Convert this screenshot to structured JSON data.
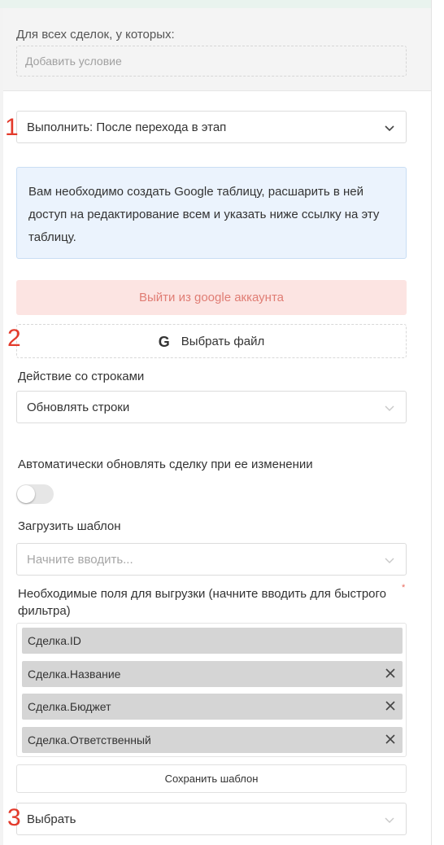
{
  "condition": {
    "title": "Для всех сделок, у которых:",
    "add_placeholder": "Добавить условие"
  },
  "markers": [
    "1",
    "2",
    "3"
  ],
  "execute_select": {
    "value": "Выполнить: После перехода в этап"
  },
  "info": {
    "text": "Вам необходимо создать Google таблицу, расшарить в ней доступ на редактирование всем и указать ниже ссылку на эту таблицу."
  },
  "logout_button": "Выйти из google аккаунта",
  "choose_file": {
    "icon": "G",
    "label": "Выбрать файл"
  },
  "row_action": {
    "label": "Действие со строками",
    "value": "Обновлять строки"
  },
  "auto_update": {
    "label": "Автоматически обновлять сделку при ее изменении",
    "enabled": false
  },
  "template": {
    "label": "Загрузить шаблон",
    "placeholder": "Начните вводить..."
  },
  "fields": {
    "label": "Необходимые поля для выгрузки (начните вводить для быстрого фильтра)",
    "required_mark": "*",
    "chips": [
      {
        "text": "Сделка.ID",
        "removable": false
      },
      {
        "text": "Сделка.Название",
        "removable": true
      },
      {
        "text": "Сделка.Бюджет",
        "removable": true
      },
      {
        "text": "Сделка.Ответственный",
        "removable": true
      }
    ]
  },
  "save_template_button": "Сохранить шаблон",
  "final_select": {
    "value": "Выбрать"
  },
  "colors": {
    "marker_red": "#e33a2b",
    "info_bg": "#ebf3fd",
    "logout_bg": "#fce4e2",
    "logout_text": "#e07d74",
    "chip_bg": "#d5d5d5"
  }
}
